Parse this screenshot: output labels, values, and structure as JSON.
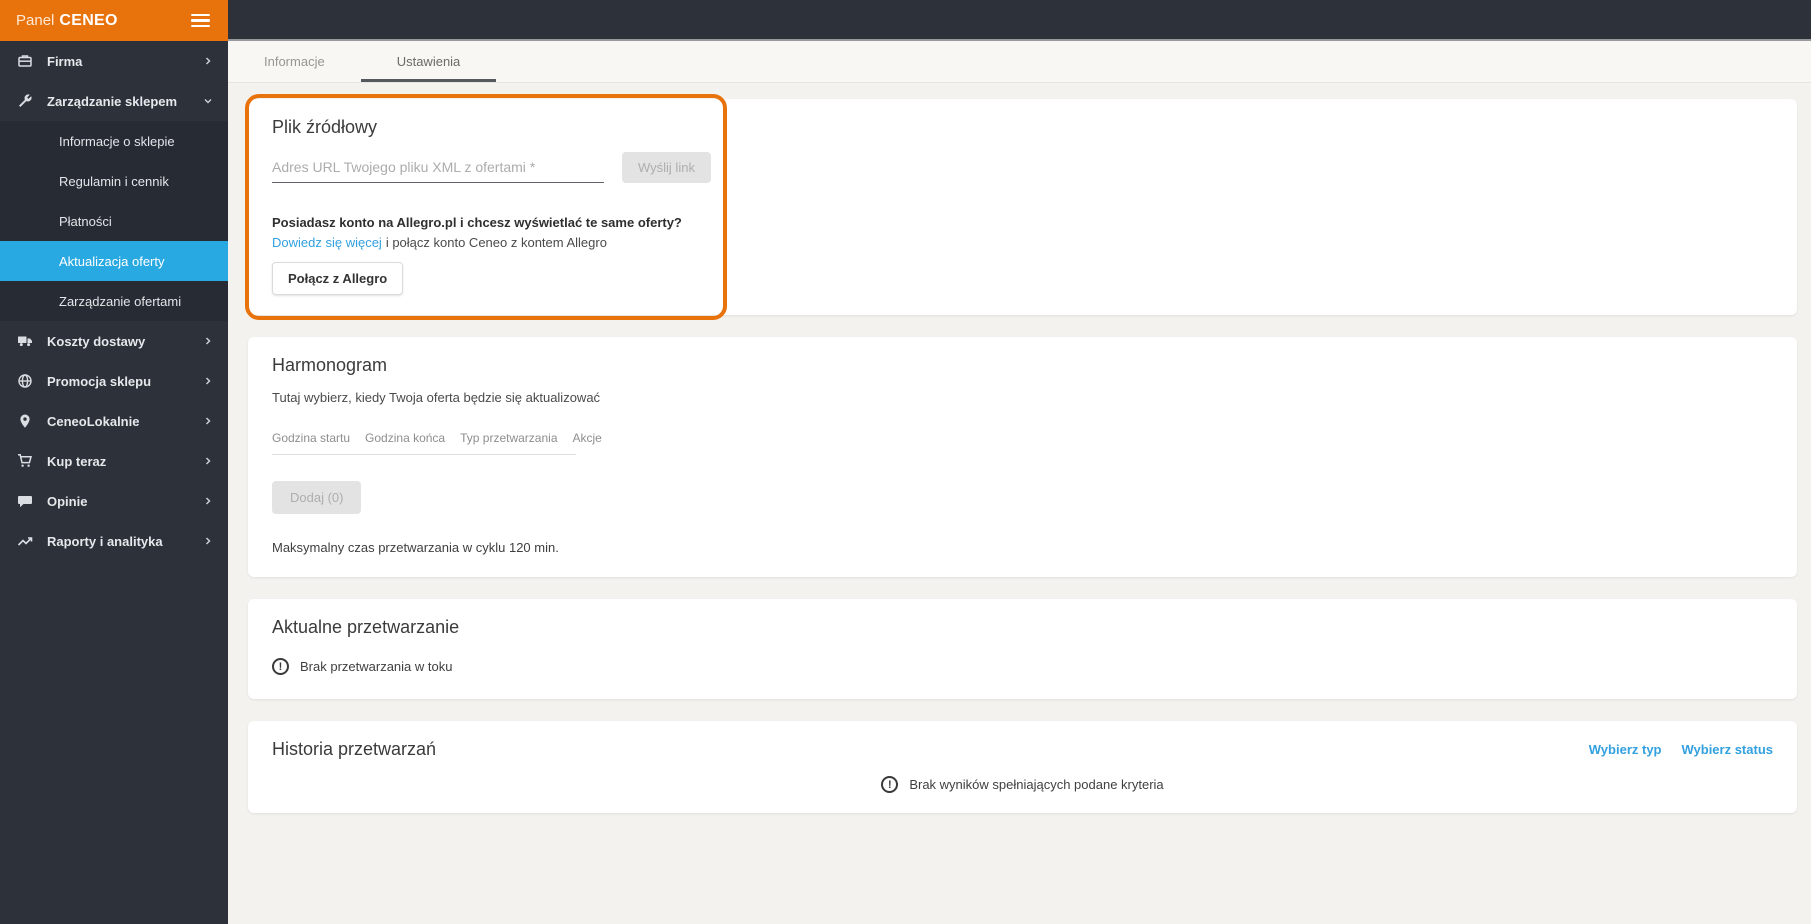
{
  "colors": {
    "brand_orange": "#E8720C",
    "active_blue": "#29A9E2",
    "link_blue": "#33A0DF",
    "sidebar_dark": "#2C313A"
  },
  "icons": {
    "exclamation_glyph": "!"
  },
  "header": {
    "brand_panel": "Panel",
    "brand_name": "CENEO"
  },
  "sidebar": {
    "items": [
      {
        "label": "Firma",
        "icon": "company-icon"
      },
      {
        "label": "Zarządzanie sklepem",
        "icon": "wrench-icon",
        "expanded": true
      },
      {
        "label": "Koszty dostawy",
        "icon": "truck-icon"
      },
      {
        "label": "Promocja sklepu",
        "icon": "globe-icon"
      },
      {
        "label": "CeneoLokalnie",
        "icon": "map-pin-icon"
      },
      {
        "label": "Kup teraz",
        "icon": "cart-icon"
      },
      {
        "label": "Opinie",
        "icon": "chat-icon"
      },
      {
        "label": "Raporty i analityka",
        "icon": "chart-icon"
      }
    ],
    "submenu": [
      {
        "label": "Informacje o sklepie"
      },
      {
        "label": "Regulamin i cennik"
      },
      {
        "label": "Płatności"
      },
      {
        "label": "Aktualizacja oferty",
        "active": true
      },
      {
        "label": "Zarządzanie ofertami"
      }
    ]
  },
  "tabs": [
    {
      "label": "Informacje"
    },
    {
      "label": "Ustawienia",
      "active": true
    }
  ],
  "source_file": {
    "title": "Plik źródłowy",
    "input_placeholder": "Adres URL Twojego pliku XML z ofertami *",
    "input_value": "",
    "send_button": "Wyślij link",
    "allegro_question": "Posiadasz konto na Allegro.pl i chcesz wyświetlać te same oferty?",
    "learn_more_link": "Dowiedz się więcej",
    "learn_more_suffix": "i połącz konto Ceneo z kontem Allegro",
    "connect_button": "Połącz z Allegro"
  },
  "schedule": {
    "title": "Harmonogram",
    "subtitle": "Tutaj wybierz, kiedy Twoja oferta będzie się aktualizować",
    "columns": [
      "Godzina startu",
      "Godzina końca",
      "Typ przetwarzania",
      "Akcje"
    ],
    "add_button": "Dodaj (0)",
    "note": "Maksymalny czas przetwarzania w cyklu 120 min."
  },
  "current_processing": {
    "title": "Aktualne przetwarzanie",
    "empty_message": "Brak przetwarzania w toku"
  },
  "history": {
    "title": "Historia przetwarzań",
    "filter_type": "Wybierz typ",
    "filter_status": "Wybierz status",
    "empty_message": "Brak wyników spełniających podane kryteria"
  }
}
